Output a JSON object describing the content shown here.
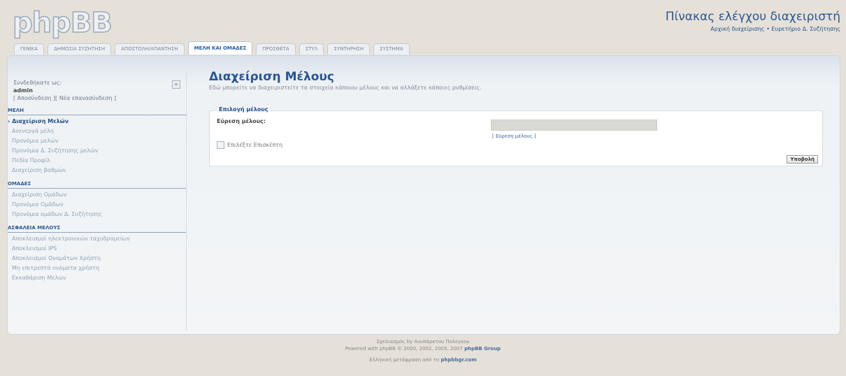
{
  "header": {
    "logo": "phpBB",
    "acp_title": "Πίνακας ελέγχου διαχειριστή",
    "acp_links": "Αρχική διαχείρισης • Ευρετήριο Δ. Συζήτησης"
  },
  "tabs": [
    {
      "label": "ΓΕΝΙΚΑ"
    },
    {
      "label": "ΔΗΜΟΣΙΑ ΣΥΖΗΤΗΣΗ"
    },
    {
      "label": "ΑΠΟΣΤΟΛΗ/ΑΠΑΝΤΗΣΗ"
    },
    {
      "label": "ΜΕΛΗ ΚΑΙ ΟΜΑΔΕΣ"
    },
    {
      "label": "ΠΡΟΣΘΕΤΑ"
    },
    {
      "label": "ΣΤΥΛ"
    },
    {
      "label": "ΣΥΝΤΗΡΗΣΗ"
    },
    {
      "label": "ΣΥΣΤΗΜΑ"
    }
  ],
  "sidebar": {
    "logged_in_label": "Συνδεθήκατε ως:",
    "username": "admin",
    "relogin": "[ Αποσύνδεση ][ Νέα επανασύνδεση ]",
    "sections": [
      {
        "title": "ΜΕΛΗ",
        "items": [
          {
            "label": "Διαχείριση Μελών"
          },
          {
            "label": "Ανενεργά μέλη"
          },
          {
            "label": "Προνόμια μελών"
          },
          {
            "label": "Προνόμια Δ. Συζήτησης μελών"
          },
          {
            "label": "Πεδία Προφίλ"
          },
          {
            "label": "Διαχείριση βαθμών"
          }
        ]
      },
      {
        "title": "ΟΜΑΔΕΣ",
        "items": [
          {
            "label": "Διαχείριση Ομάδων"
          },
          {
            "label": "Προνόμια Ομάδων"
          },
          {
            "label": "Προνόμια ομάδων Δ. Συζήτησης"
          }
        ]
      },
      {
        "title": "ΑΣΦΑΛΕΙΑ ΜΕΛΟΥΣ",
        "items": [
          {
            "label": "Αποκλεισμοί ηλεκτρονικών ταχυδρομείων"
          },
          {
            "label": "Αποκλεισμοί IPS"
          },
          {
            "label": "Αποκλεισμοί Ονομάτων Χρήστη"
          },
          {
            "label": "Μη επιτρεπτά ονόματα χρήστη"
          },
          {
            "label": "Εκκαθάριση Μελών"
          }
        ]
      }
    ]
  },
  "main": {
    "title": "Διαχείριση Μέλους",
    "description": "Εδώ μπορείτε να διαχειριστείτε τα στοιχεία κάποιου μέλους και να αλλάξετε κάποιες ρυθμίσεις.",
    "fieldset_legend": "Επιλογή μέλους",
    "field_label": "Εύρεση μέλους:",
    "field_value": "",
    "find_link": "[ Εύρεση μέλους ]",
    "checkbox_label": "Επιλέξτε Επισκέπτη",
    "submit_label": "Υποβολή"
  },
  "footer": {
    "line1": "Σχεδιασμός by Ανυπάρκτου Πολεγκου",
    "line2_prefix": "Powered with phpBB © 2000, 2002, 2005, 2007",
    "line2_brand": "phpBB Group",
    "line3_prefix": "Ελληνική μετάφραση από το",
    "line3_brand": "phpbbgr.com"
  }
}
